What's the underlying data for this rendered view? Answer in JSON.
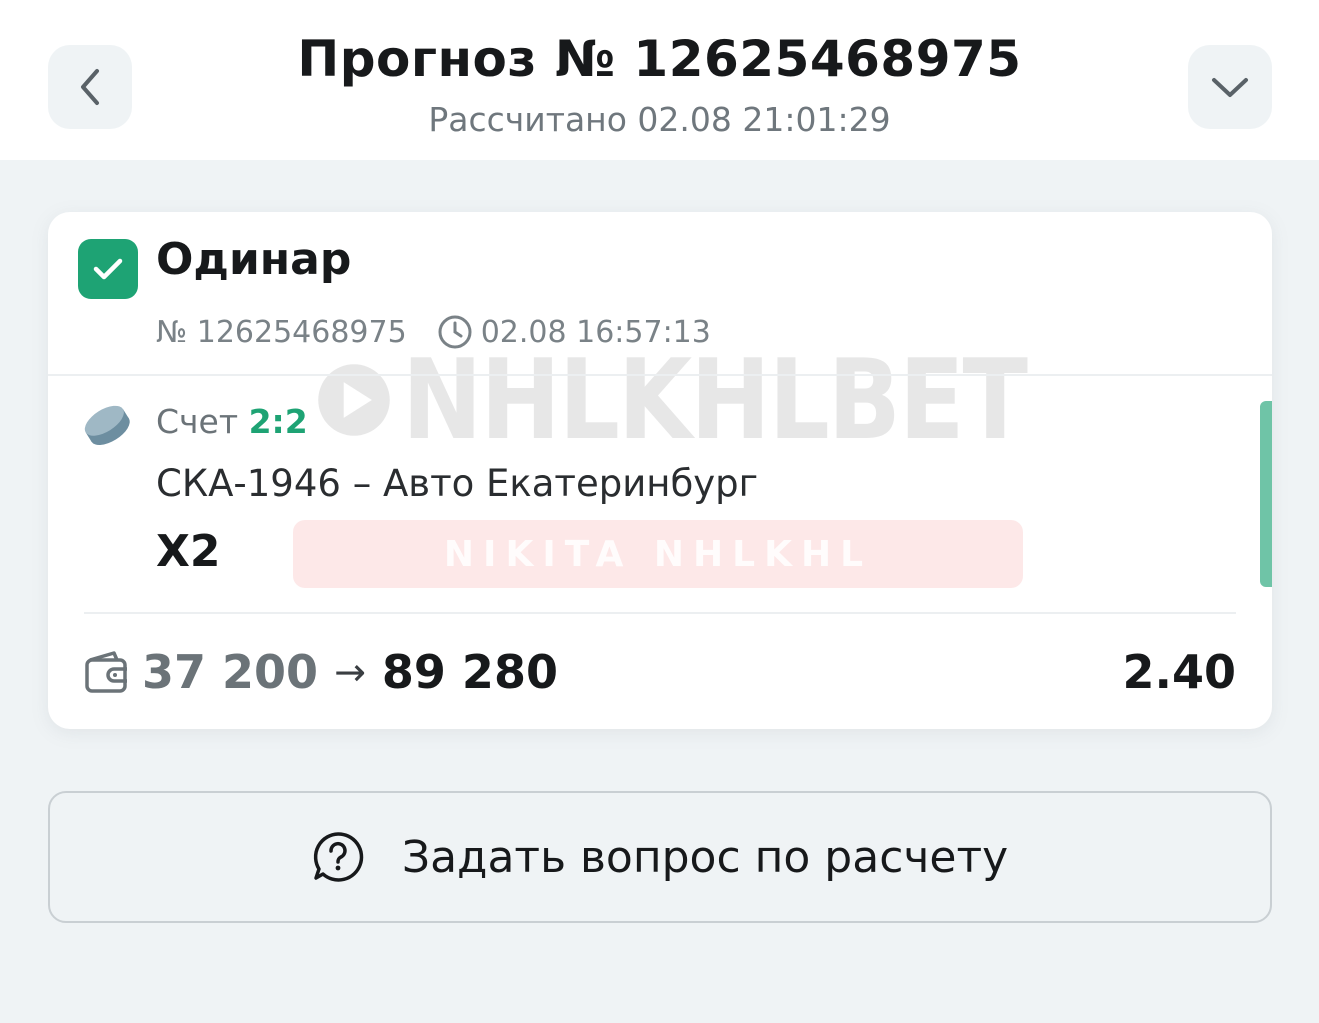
{
  "header": {
    "title": "Прогноз № 12625468975",
    "subtitle": "Рассчитано 02.08 21:01:29",
    "back_icon": "chevron-left-icon",
    "collapse_icon": "chevron-down-icon"
  },
  "bet": {
    "type": "Одинар",
    "number": "№ 12625468975",
    "time": "02.08 16:57:13",
    "status_icon": "check-icon",
    "status_color": "#1ea374",
    "score_label": "Счет",
    "score_value": "2:2",
    "teams": "СКА-1946 – Авто Екатеринбург",
    "outcome": "X2",
    "stake": "37 200",
    "arrow": "→",
    "payout": "89 280",
    "coefficient": "2.40"
  },
  "watermark": {
    "logo_text": "NHLKHLBET",
    "banner_text": "NIKITA NHLKHL"
  },
  "ask_button": {
    "label": "Задать вопрос по расчету",
    "icon": "question-chat-icon"
  }
}
